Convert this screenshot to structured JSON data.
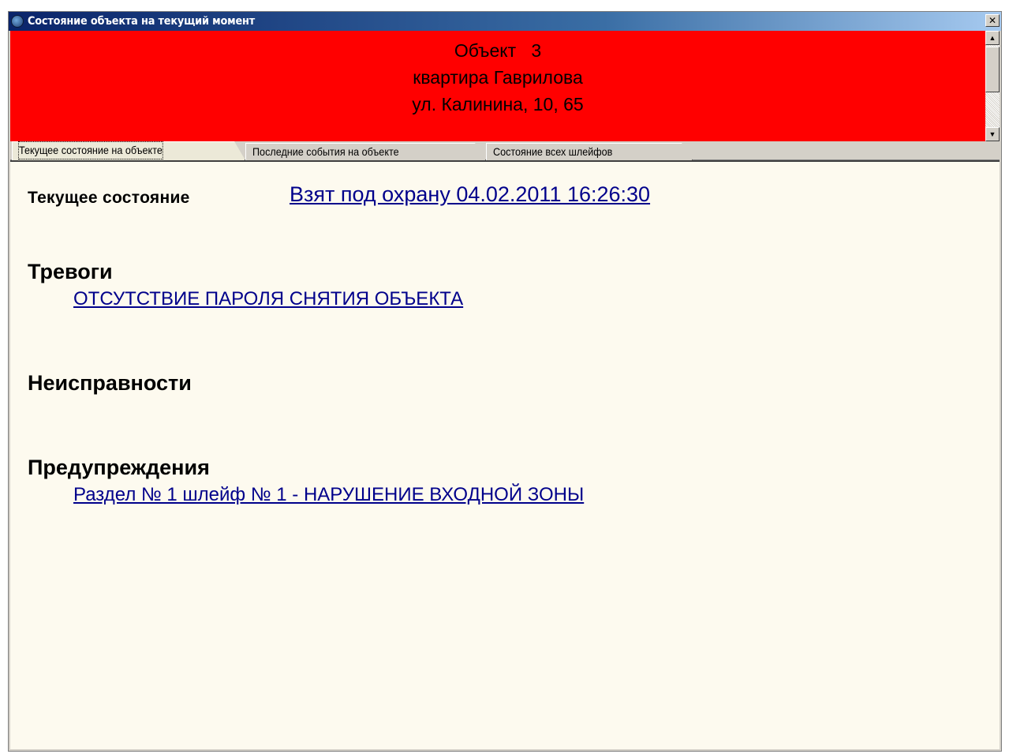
{
  "window": {
    "title": "Состояние объекта на текущий момент",
    "close_label": "✕"
  },
  "header": {
    "line1": "Объект   3",
    "line2": "квартира Гаврилова",
    "line3": "ул. Калинина, 10, 65",
    "background_color": "#ff0000"
  },
  "scrollbar": {
    "up_arrow": "▲",
    "down_arrow": "▼"
  },
  "tabs": [
    {
      "label": "Текущее состояние на объекте",
      "active": true
    },
    {
      "label": "Последние события на объекте",
      "active": false
    },
    {
      "label": "Состояние всех шлейфов",
      "active": false
    }
  ],
  "content": {
    "current_state_label": "Текущее состояние",
    "current_state_value": "Взят под охрану 04.02.2011 16:26:30",
    "alarms_title": "Тревоги",
    "alarms_items": [
      "ОТСУТСТВИЕ ПАРОЛЯ СНЯТИЯ ОБЪЕКТА"
    ],
    "faults_title": "Неисправности",
    "warnings_title": "Предупреждения",
    "warnings_items": [
      "Раздел № 1 шлейф № 1 - НАРУШЕНИЕ ВХОДНОЙ ЗОНЫ"
    ],
    "link_color": "#00008b",
    "background_color": "#fdfaef"
  }
}
